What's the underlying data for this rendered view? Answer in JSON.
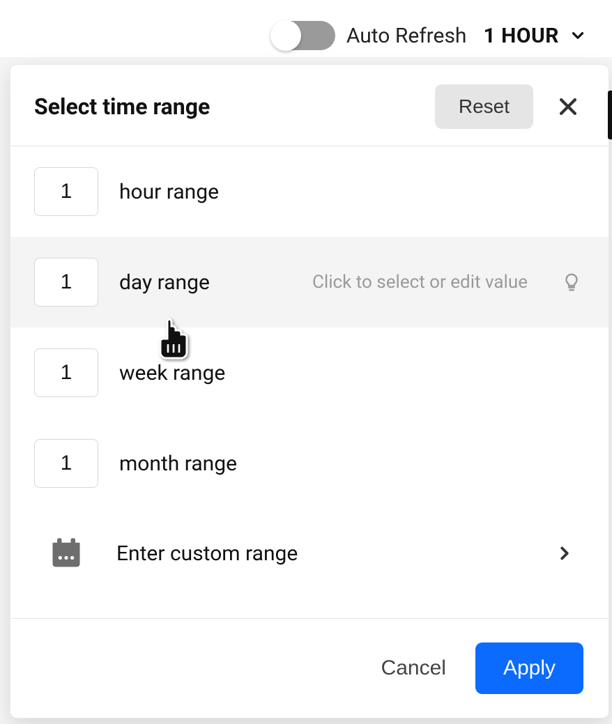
{
  "topbar": {
    "auto_refresh_label": "Auto Refresh",
    "range_selected": "1 HOUR",
    "toggle_on": false
  },
  "dialog": {
    "title": "Select time range",
    "reset_label": "Reset",
    "hint": "Click to select or edit value",
    "rows": [
      {
        "value": "1",
        "label": "hour range",
        "hovered": false
      },
      {
        "value": "1",
        "label": "day range",
        "hovered": true
      },
      {
        "value": "1",
        "label": "week range",
        "hovered": false
      },
      {
        "value": "1",
        "label": "month range",
        "hovered": false
      }
    ],
    "custom_label": "Enter custom range",
    "cancel_label": "Cancel",
    "apply_label": "Apply"
  }
}
